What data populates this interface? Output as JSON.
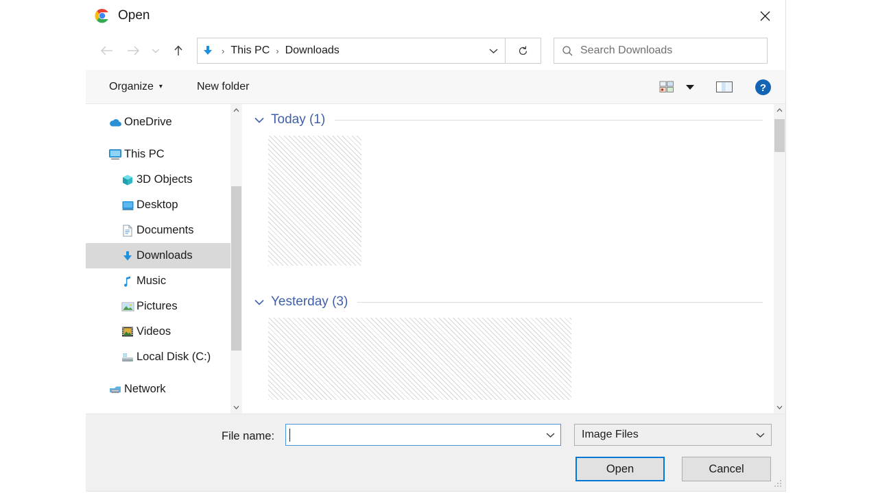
{
  "window": {
    "title": "Open",
    "app_icon": "chrome-logo-icon",
    "close_label": "✕"
  },
  "nav": {
    "back_icon": "←",
    "forward_icon": "→",
    "recent_icon": "⌄",
    "up_icon": "↑",
    "refresh_icon": "↻",
    "location_icon": "downloads-arrow-icon",
    "breadcrumbs": [
      "This PC",
      "Downloads"
    ],
    "separator": "›",
    "dropdown_icon": "⌄"
  },
  "search": {
    "placeholder": "Search Downloads",
    "icon": "search-icon"
  },
  "toolbar": {
    "organize_label": "Organize",
    "organize_caret": "▾",
    "new_folder_label": "New folder",
    "view_icon": "view-options-icon",
    "view_caret": "▾",
    "preview_pane_icon": "preview-pane-icon",
    "help_icon": "help-icon",
    "help_glyph": "?"
  },
  "sidebar": {
    "items": [
      {
        "label": "OneDrive",
        "icon": "onedrive-cloud-icon",
        "level": 0,
        "selected": false
      },
      {
        "label": "This PC",
        "icon": "this-pc-monitor-icon",
        "level": 0,
        "selected": false
      },
      {
        "label": "3D Objects",
        "icon": "3d-objects-icon",
        "level": 1,
        "selected": false
      },
      {
        "label": "Desktop",
        "icon": "desktop-icon",
        "level": 1,
        "selected": false
      },
      {
        "label": "Documents",
        "icon": "documents-icon",
        "level": 1,
        "selected": false
      },
      {
        "label": "Downloads",
        "icon": "downloads-arrow-icon",
        "level": 1,
        "selected": true
      },
      {
        "label": "Music",
        "icon": "music-note-icon",
        "level": 1,
        "selected": false
      },
      {
        "label": "Pictures",
        "icon": "pictures-icon",
        "level": 1,
        "selected": false
      },
      {
        "label": "Videos",
        "icon": "videos-icon",
        "level": 1,
        "selected": false
      },
      {
        "label": "Local Disk (C:)",
        "icon": "local-disk-icon",
        "level": 1,
        "selected": false
      },
      {
        "label": "Network",
        "icon": "network-icon",
        "level": 0,
        "selected": false
      }
    ],
    "scroll_up_icon": "∧",
    "scroll_down_icon": "∨"
  },
  "filelist": {
    "groups": [
      {
        "caret": "∨",
        "label": "Today (1)",
        "count": 1,
        "thumb_kind": "single"
      },
      {
        "caret": "∨",
        "label": "Yesterday (3)",
        "count": 3,
        "thumb_kind": "wide"
      }
    ],
    "scroll_up_icon": "∧",
    "scroll_down_icon": "∨"
  },
  "footer": {
    "file_name_label": "File name:",
    "file_name_value": "",
    "file_name_dropdown_icon": "⌄",
    "file_type_value": "Image Files",
    "file_type_dropdown_icon": "⌄",
    "open_label": "Open",
    "cancel_label": "Cancel"
  },
  "colors": {
    "accent": "#0078d7",
    "group_header": "#3f5fa8",
    "selection": "#d9d9d9",
    "footer_bg": "#f0f0f0",
    "toolbar_bg": "#f7f7f7"
  }
}
